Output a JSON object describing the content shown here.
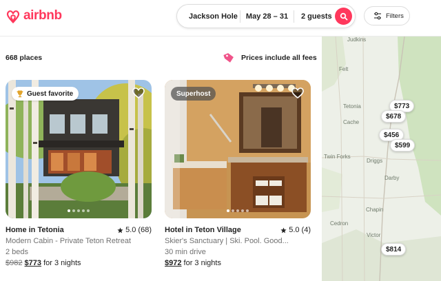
{
  "header": {
    "logo_text": "airbnb",
    "search": {
      "location": "Jackson Hole",
      "dates": "May 28 – 31",
      "guests": "2 guests"
    },
    "filters_label": "Filters"
  },
  "results": {
    "count": "668 places",
    "fees_note": "Prices include all fees"
  },
  "listings": [
    {
      "badge": "Guest favorite",
      "title": "Home in Tetonia",
      "rating": "5.0 (68)",
      "subtitle": "Modern Cabin - Private Teton Retreat",
      "detail": "2 beds",
      "original_price": "$982",
      "price": "$773",
      "price_suffix": " for 3 nights",
      "photo_count": 5,
      "active_photo": 1
    },
    {
      "badge": "Superhost",
      "title": "Hotel in Teton Village",
      "rating": "5.0 (4)",
      "subtitle": "Skier's Sanctuary | Ski. Pool. Good...",
      "detail": "30 min drive",
      "original_price": "",
      "price": "$972",
      "price_suffix": " for 3 nights",
      "photo_count": 5,
      "active_photo": 1
    }
  ],
  "map": {
    "places": [
      "Judkins",
      "Felt",
      "Tetonia",
      "Cache",
      "Twin Forks",
      "Driggs",
      "Darby",
      "Chapin",
      "Cedron",
      "Victor"
    ],
    "price_pins": [
      "$773",
      "$678",
      "$456",
      "$599",
      "$814"
    ]
  },
  "colors": {
    "brand": "#FF385C",
    "text": "#222222",
    "muted": "#717171",
    "map_land": "#EDF0E8",
    "map_green": "#CFE3BF",
    "road": "#C9C3B6"
  },
  "icons": [
    "airbnb-logo-icon",
    "search-icon",
    "filters-icon",
    "price-tag-icon",
    "trophy-icon",
    "heart-icon",
    "star-icon"
  ]
}
